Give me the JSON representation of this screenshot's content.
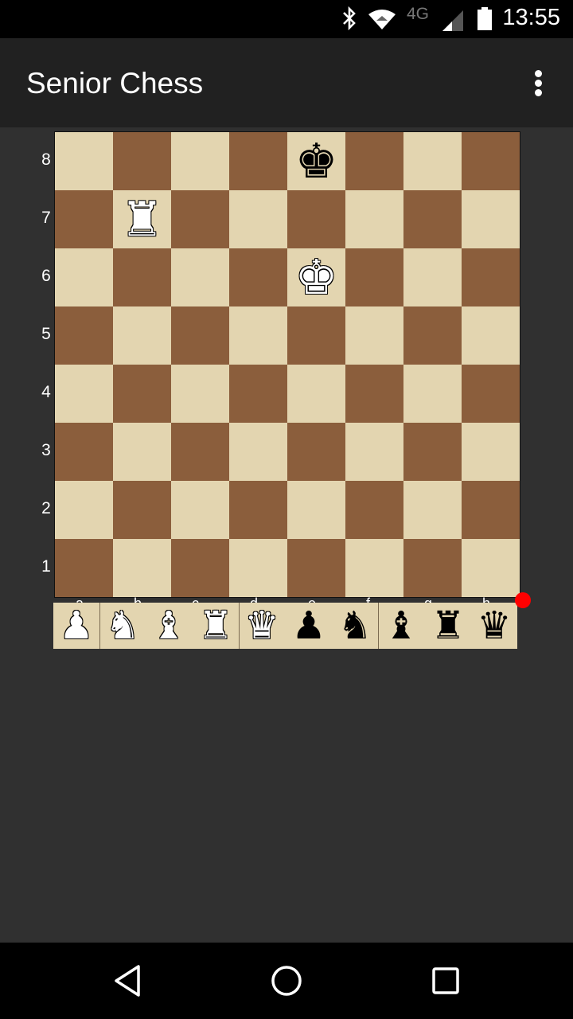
{
  "status_bar": {
    "time": "13:55",
    "network": "4G",
    "icons": [
      "bluetooth-icon",
      "wifi-icon",
      "cell-signal-icon",
      "battery-icon"
    ]
  },
  "app_bar": {
    "title": "Senior Chess",
    "menu_icon": "more-vert-icon"
  },
  "board": {
    "ranks": [
      "8",
      "7",
      "6",
      "5",
      "4",
      "3",
      "2",
      "1"
    ],
    "files": [
      "a",
      "b",
      "c",
      "d",
      "e",
      "f",
      "g",
      "h"
    ],
    "light_color": "#e3d5b0",
    "dark_color": "#8b5e3c",
    "pieces": [
      {
        "square": "e8",
        "piece": "king",
        "color": "black",
        "glyph": "♚"
      },
      {
        "square": "b7",
        "piece": "rook",
        "color": "white",
        "glyph": "♜"
      },
      {
        "square": "e6",
        "piece": "king",
        "color": "white",
        "glyph": "♚"
      }
    ]
  },
  "piece_tray": {
    "pieces": [
      {
        "piece": "pawn",
        "color": "white",
        "glyph": "♟"
      },
      {
        "piece": "knight",
        "color": "white",
        "glyph": "♞"
      },
      {
        "piece": "bishop",
        "color": "white",
        "glyph": "♝"
      },
      {
        "piece": "rook",
        "color": "white",
        "glyph": "♜"
      },
      {
        "piece": "queen",
        "color": "white",
        "glyph": "♛"
      },
      {
        "piece": "pawn",
        "color": "black",
        "glyph": "♟"
      },
      {
        "piece": "knight",
        "color": "black",
        "glyph": "♞"
      },
      {
        "piece": "bishop",
        "color": "black",
        "glyph": "♝"
      },
      {
        "piece": "rook",
        "color": "black",
        "glyph": "♜"
      },
      {
        "piece": "queen",
        "color": "black",
        "glyph": "♛"
      }
    ],
    "indicator_color": "#ff0000"
  },
  "nav_bar": {
    "buttons": [
      "back",
      "home",
      "recents"
    ]
  }
}
